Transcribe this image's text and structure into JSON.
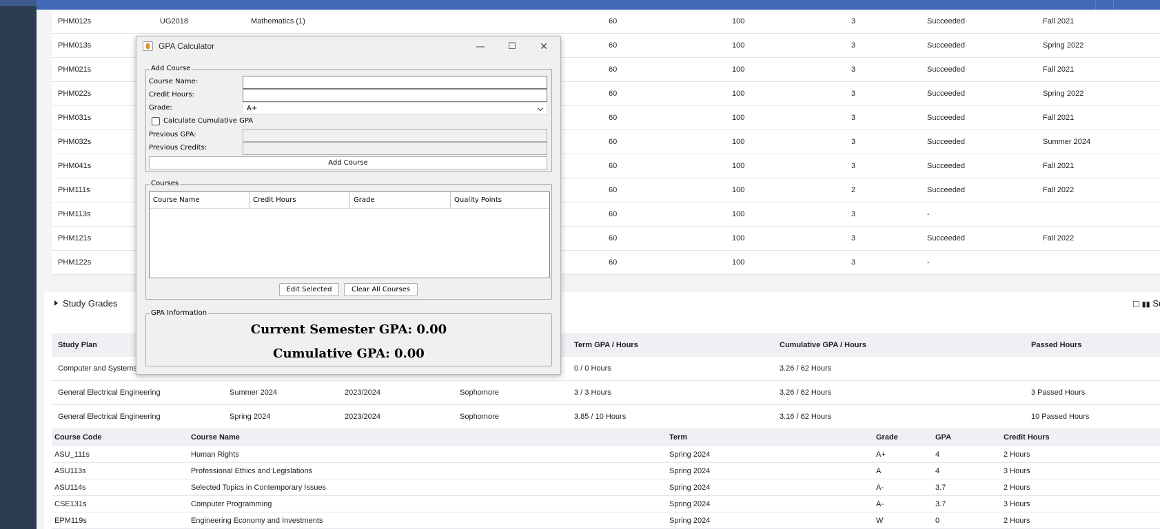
{
  "upper_rows": [
    {
      "code": "PHM012s",
      "req": "UG2018",
      "name": "Mathematics (1)",
      "min": "60",
      "max": "100",
      "hours": "3",
      "status": "Succeeded",
      "term": "Fall 2021"
    },
    {
      "code": "PHM013s",
      "req": "",
      "name": "",
      "min": "60",
      "max": "100",
      "hours": "3",
      "status": "Succeeded",
      "term": "Spring 2022"
    },
    {
      "code": "PHM021s",
      "req": "",
      "name": "",
      "min": "60",
      "max": "100",
      "hours": "3",
      "status": "Succeeded",
      "term": "Fall 2021"
    },
    {
      "code": "PHM022s",
      "req": "",
      "name": "",
      "min": "60",
      "max": "100",
      "hours": "3",
      "status": "Succeeded",
      "term": "Spring 2022"
    },
    {
      "code": "PHM031s",
      "req": "",
      "name": "",
      "min": "60",
      "max": "100",
      "hours": "3",
      "status": "Succeeded",
      "term": "Fall 2021"
    },
    {
      "code": "PHM032s",
      "req": "",
      "name": "",
      "min": "60",
      "max": "100",
      "hours": "3",
      "status": "Succeeded",
      "term": "Summer 2024"
    },
    {
      "code": "PHM041s",
      "req": "",
      "name": "",
      "min": "60",
      "max": "100",
      "hours": "3",
      "status": "Succeeded",
      "term": "Fall 2021"
    },
    {
      "code": "PHM111s",
      "req": "",
      "name": "",
      "min": "60",
      "max": "100",
      "hours": "2",
      "status": "Succeeded",
      "term": "Fall 2022"
    },
    {
      "code": "PHM113s",
      "req": "",
      "name": "",
      "min": "60",
      "max": "100",
      "hours": "3",
      "status": "-",
      "term": ""
    },
    {
      "code": "PHM121s",
      "req": "",
      "name": "",
      "min": "60",
      "max": "100",
      "hours": "3",
      "status": "Succeeded",
      "term": "Fall 2022"
    },
    {
      "code": "PHM122s",
      "req": "",
      "name": "",
      "min": "60",
      "max": "100",
      "hours": "3",
      "status": "-",
      "term": ""
    }
  ],
  "study_grades": {
    "title": "Study Grades",
    "right_label": "Su"
  },
  "study_plan": {
    "headers": [
      "Study Plan",
      "",
      "",
      "",
      "Term GPA / Hours",
      "Cumulative GPA / Hours",
      "Passed Hours"
    ],
    "rows": [
      [
        "Computer and Systems E",
        "",
        "",
        "",
        "0 / 0 Hours",
        "3.26 / 62 Hours",
        ""
      ],
      [
        "General Electrical Engineering",
        "Summer 2024",
        "2023/2024",
        "Sophomore",
        "3 / 3 Hours",
        "3.26 / 62 Hours",
        "3 Passed Hours"
      ],
      [
        "General Electrical Engineering",
        "Spring 2024",
        "2023/2024",
        "Sophomore",
        "3.85 / 10 Hours",
        "3.16 / 62 Hours",
        "10 Passed Hours"
      ]
    ]
  },
  "courses_table": {
    "headers": [
      "Course Code",
      "Course Name",
      "Term",
      "Grade",
      "GPA",
      "Credit Hours"
    ],
    "rows": [
      [
        "ASU_111s",
        "Human Rights",
        "Spring 2024",
        "A+",
        "4",
        "2 Hours"
      ],
      [
        "ASU113s",
        "Professional Ethics and Legislations",
        "Spring 2024",
        "A",
        "4",
        "3 Hours"
      ],
      [
        "ASU114s",
        "Selected Topics in Contemporary Issues",
        "Spring 2024",
        "A-",
        "3.7",
        "2 Hours"
      ],
      [
        "CSE131s",
        "Computer Programming",
        "Spring 2024",
        "A-",
        "3.7",
        "3 Hours"
      ],
      [
        "EPM119s",
        "Engineering Economy and Investments",
        "Spring 2024",
        "W",
        "0",
        "2 Hours"
      ]
    ]
  },
  "gpa_window": {
    "title": "GPA Calculator",
    "minimize": "—",
    "maximize": "☐",
    "close": "✕",
    "add_course": {
      "legend": "Add Course",
      "course_name_label": "Course Name:",
      "course_name_value": "",
      "credit_hours_label": "Credit Hours:",
      "credit_hours_value": "",
      "grade_label": "Grade:",
      "grade_value": "A+",
      "cumulative_checkbox_label": "Calculate Cumulative GPA",
      "cumulative_checked": false,
      "previous_gpa_label": "Previous GPA:",
      "previous_credits_label": "Previous Credits:",
      "add_button": "Add Course"
    },
    "courses": {
      "legend": "Courses",
      "columns": [
        "Course Name",
        "Credit Hours",
        "Grade",
        "Quality Points"
      ],
      "edit_button": "Edit Selected",
      "clear_button": "Clear All Courses"
    },
    "gpa_info": {
      "legend": "GPA Information",
      "current": "Current Semester GPA: 0.00",
      "cumulative": "Cumulative GPA: 0.00"
    }
  },
  "colors": {
    "sidebar": "#2c3d51",
    "topbar": "#4268b6",
    "content_bg": "#f3f4f6",
    "window_bg": "#f0f0f0"
  }
}
